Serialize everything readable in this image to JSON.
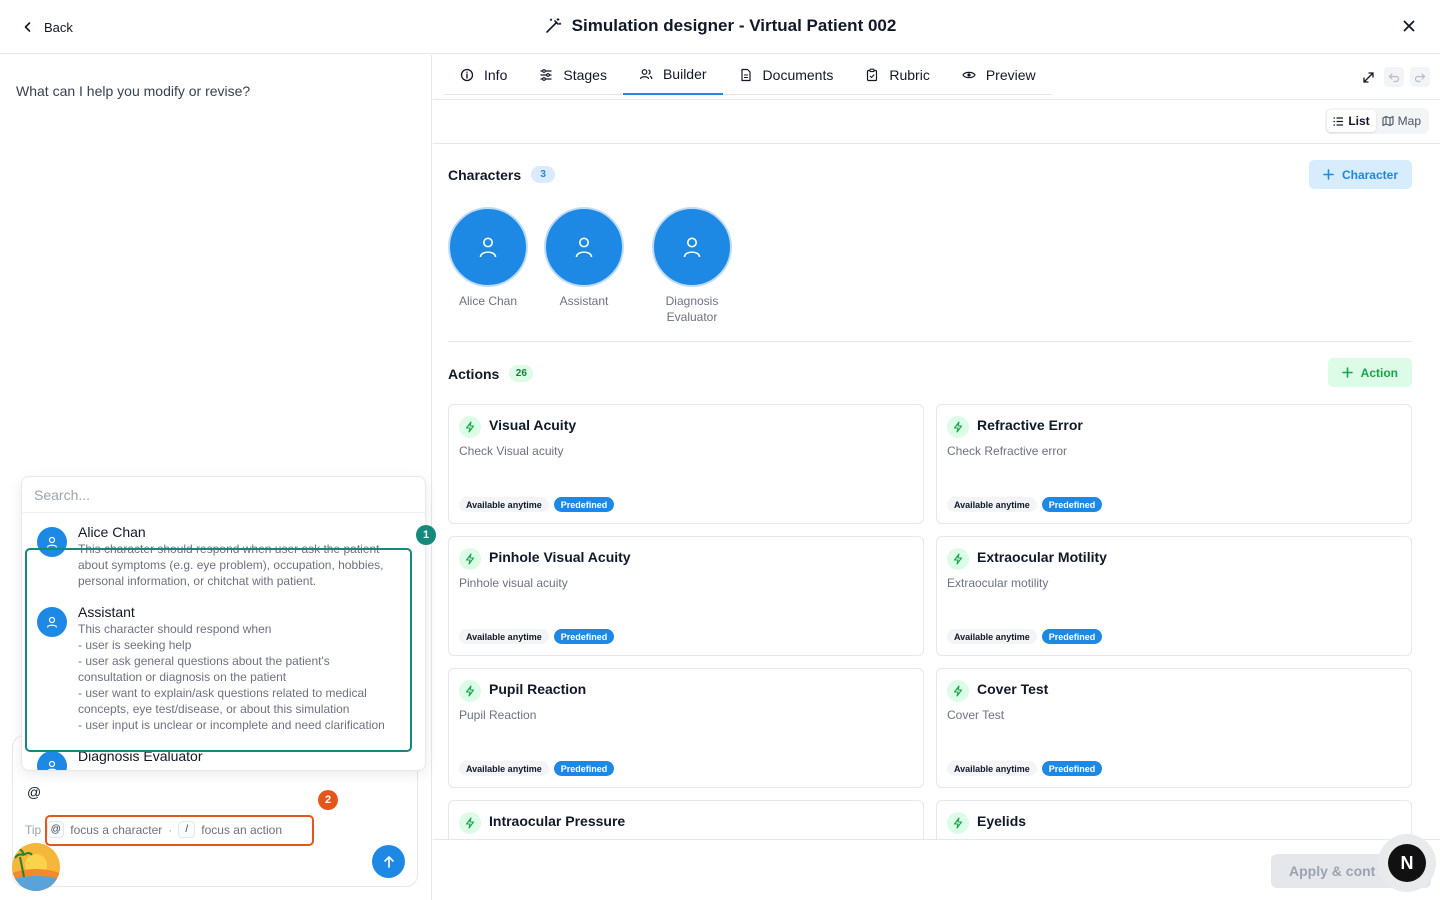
{
  "header": {
    "back_label": "Back",
    "title": "Simulation designer - Virtual Patient 002"
  },
  "chat": {
    "prompt": "What can I help you modify or revise?",
    "input_value": "@",
    "tip_label": "Tip",
    "tip_char_key": "@",
    "tip_char_text": "focus a character",
    "tip_separator": "·",
    "tip_action_key": "/",
    "tip_action_text": "focus an action",
    "mention_search_placeholder": "Search...",
    "mentions": [
      {
        "name": "Alice Chan",
        "description": "This character should respond when user ask the patient\nabout symptoms (e.g. eye problem), occupation, hobbies,\npersonal information, or chitchat with patient."
      },
      {
        "name": "Assistant",
        "description": "This character should respond when\n- user is seeking help\n- user ask general questions about the patient's\nconsultation or diagnosis on the patient\n- user want to explain/ask questions related to medical\nconcepts, eye test/disease, or about this simulation\n- user input is unclear or incomplete and need clarification"
      },
      {
        "name": "Diagnosis Evaluator",
        "description": ""
      }
    ],
    "annotations": [
      "1",
      "2"
    ]
  },
  "tabs": [
    {
      "label": "Info",
      "icon": "info-icon"
    },
    {
      "label": "Stages",
      "icon": "stages-icon"
    },
    {
      "label": "Builder",
      "icon": "users-icon"
    },
    {
      "label": "Documents",
      "icon": "document-icon"
    },
    {
      "label": "Rubric",
      "icon": "clipboard-icon"
    },
    {
      "label": "Preview",
      "icon": "eye-icon"
    }
  ],
  "active_tab": "Builder",
  "view_toggle": {
    "list": "List",
    "map": "Map",
    "active": "List"
  },
  "characters": {
    "title": "Characters",
    "count": "3",
    "add_label": "Character",
    "items": [
      {
        "name": "Alice Chan"
      },
      {
        "name": "Assistant"
      },
      {
        "name": "Diagnosis Evaluator"
      }
    ]
  },
  "actions": {
    "title": "Actions",
    "count": "26",
    "add_label": "Action",
    "tag_available": "Available anytime",
    "tag_predefined": "Predefined",
    "items": [
      {
        "title": "Visual Acuity",
        "desc": "Check Visual acuity"
      },
      {
        "title": "Refractive Error",
        "desc": "Check Refractive error"
      },
      {
        "title": "Pinhole Visual Acuity",
        "desc": "Pinhole visual acuity"
      },
      {
        "title": "Extraocular Motility",
        "desc": "Extraocular motility"
      },
      {
        "title": "Pupil Reaction",
        "desc": "Pupil Reaction"
      },
      {
        "title": "Cover Test",
        "desc": "Cover Test"
      },
      {
        "title": "Intraocular Pressure",
        "desc": ""
      },
      {
        "title": "Eyelids",
        "desc": ""
      }
    ]
  },
  "footer": {
    "apply_label": "Apply & cont",
    "badge_letter": "N"
  },
  "colors": {
    "primary": "#1e88e5",
    "accent_green": "#22c55e",
    "annotation_teal": "#138a7c",
    "annotation_orange": "#e4571c"
  }
}
